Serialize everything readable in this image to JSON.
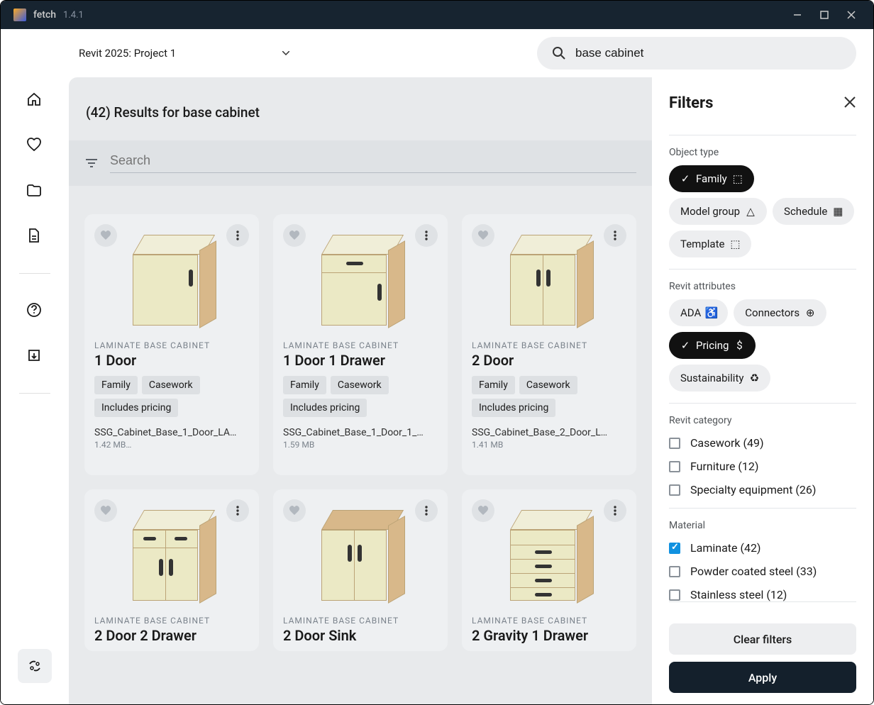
{
  "app": {
    "name": "fetch",
    "version": "1.4.1"
  },
  "topbar": {
    "project": "Revit 2025: Project 1",
    "search_value": "base cabinet"
  },
  "results": {
    "count": "(42)",
    "label": "Results for base cabinet",
    "header": "(42) Results for base cabinet",
    "search_placeholder": "Search"
  },
  "items": [
    {
      "category": "LAMINATE BASE CABINET",
      "title": "1 Door",
      "badges": [
        "Family",
        "Casework",
        "Includes pricing"
      ],
      "file": "SSG_Cabinet_Base_1_Door_LA…",
      "size": "1.42 MB…"
    },
    {
      "category": "LAMINATE BASE CABINET",
      "title": "1 Door 1 Drawer",
      "badges": [
        "Family",
        "Casework",
        "Includes pricing"
      ],
      "file": "SSG_Cabinet_Base_1_Door_1_…",
      "size": "1.59 MB"
    },
    {
      "category": "LAMINATE BASE CABINET",
      "title": "2 Door",
      "badges": [
        "Family",
        "Casework",
        "Includes pricing"
      ],
      "file": "SSG_Cabinet_Base_2_Door_L…",
      "size": "1.41 MB"
    },
    {
      "category": "LAMINATE BASE CABINET",
      "title": "2 Door 2 Drawer",
      "badges": [],
      "file": "",
      "size": ""
    },
    {
      "category": "LAMINATE BASE CABINET",
      "title": "2 Door Sink",
      "badges": [],
      "file": "",
      "size": ""
    },
    {
      "category": "LAMINATE BASE CABINET",
      "title": "2 Gravity 1 Drawer",
      "badges": [],
      "file": "",
      "size": ""
    }
  ],
  "filters": {
    "title": "Filters",
    "object_type_label": "Object type",
    "object_types": [
      {
        "label": "Family",
        "active": true
      },
      {
        "label": "Model group",
        "active": false
      },
      {
        "label": "Schedule",
        "active": false
      },
      {
        "label": "Template",
        "active": false
      }
    ],
    "attributes_label": "Revit attributes",
    "attributes": [
      {
        "label": "ADA",
        "active": false
      },
      {
        "label": "Connectors",
        "active": false
      },
      {
        "label": "Pricing",
        "active": true
      },
      {
        "label": "Sustainability",
        "active": false
      }
    ],
    "category_label": "Revit category",
    "categories": [
      {
        "label": "Casework (49)",
        "checked": false
      },
      {
        "label": "Furniture (12)",
        "checked": false
      },
      {
        "label": "Specialty equipment (26)",
        "checked": false
      }
    ],
    "material_label": "Material",
    "materials": [
      {
        "label": "Laminate (42)",
        "checked": true
      },
      {
        "label": "Powder coated steel (33)",
        "checked": false
      },
      {
        "label": "Stainless steel (12)",
        "checked": false
      }
    ],
    "clear": "Clear filters",
    "apply": "Apply"
  }
}
